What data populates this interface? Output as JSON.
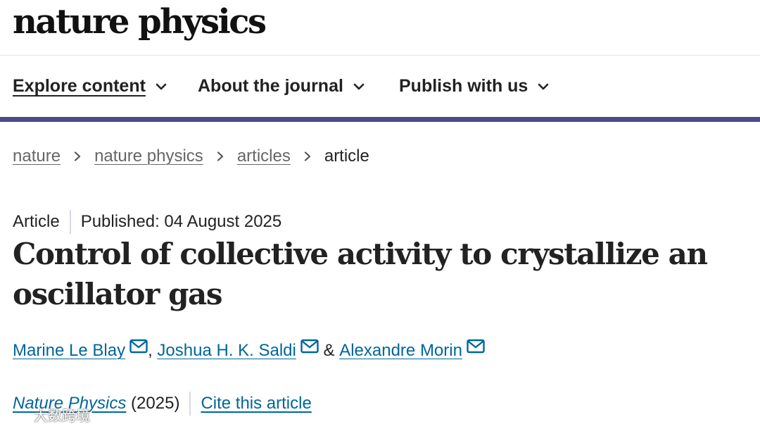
{
  "site": {
    "logo_text": "nature physics"
  },
  "nav": {
    "items": [
      {
        "label": "Explore content"
      },
      {
        "label": "About the journal"
      },
      {
        "label": "Publish with us"
      }
    ]
  },
  "colors": {
    "accent_bar": "#4b4a8f",
    "link": "#006699",
    "breadcrumb_link": "#666666"
  },
  "breadcrumb": {
    "items": [
      {
        "label": "nature"
      },
      {
        "label": "nature physics"
      },
      {
        "label": "articles"
      },
      {
        "label": "article"
      }
    ]
  },
  "article": {
    "type": "Article",
    "published": "Published: 04 August 2025",
    "title": "Control of collective activity to crystallize an oscillator gas",
    "authors": [
      {
        "name": "Marine Le Blay",
        "separator": ", "
      },
      {
        "name": "Joshua H. K. Saldi",
        "separator": " & "
      },
      {
        "name": "Alexandre Morin",
        "separator": ""
      }
    ],
    "journal": "Nature Physics",
    "year": " (2025)",
    "cite_label": "Cite this article"
  },
  "watermark": {
    "text": "大数跨境"
  }
}
